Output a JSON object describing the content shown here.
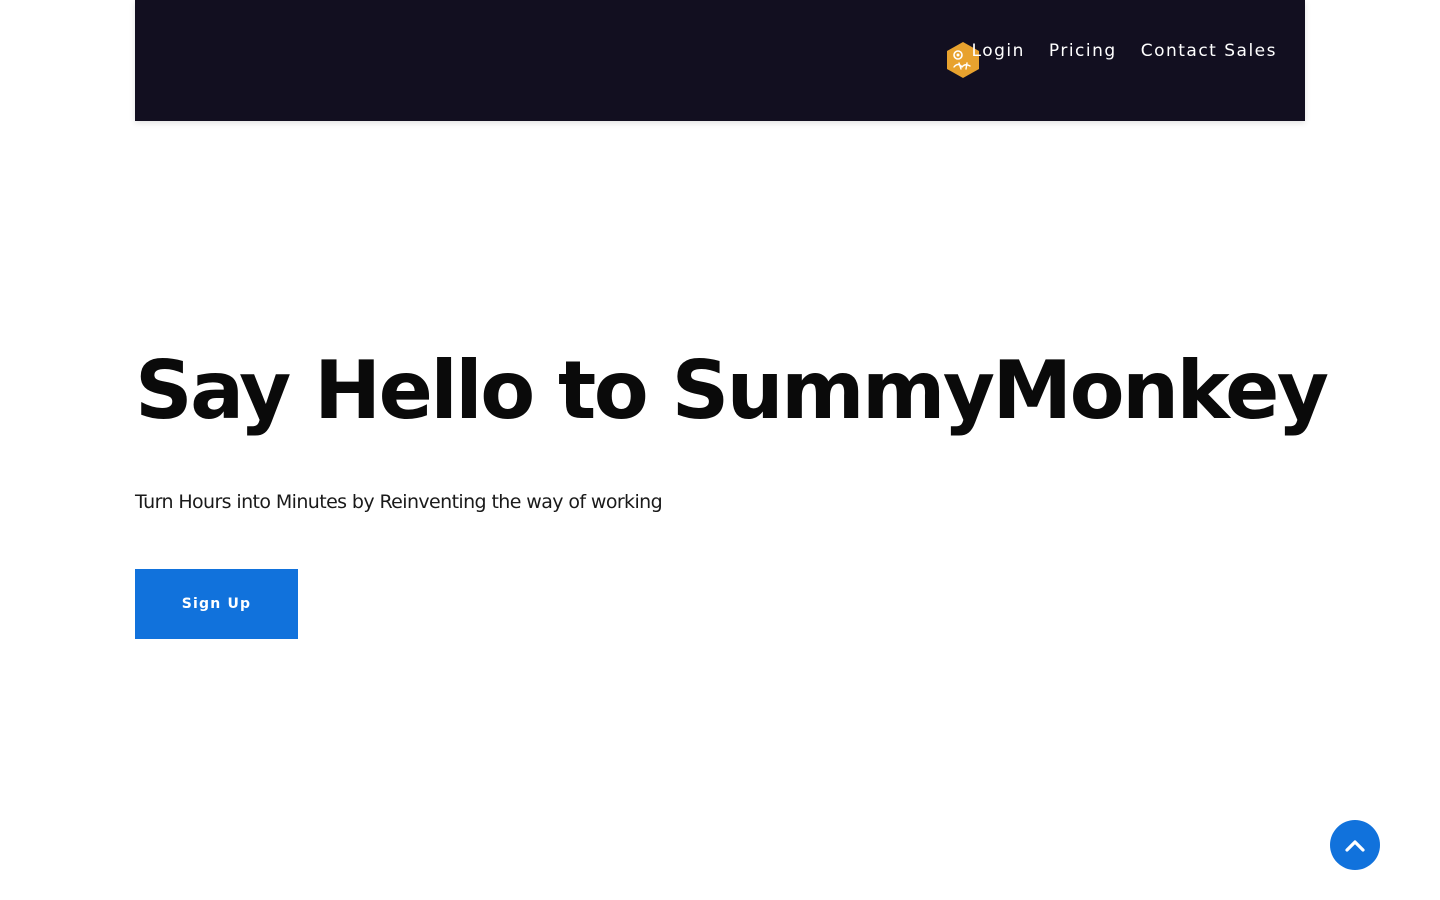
{
  "header": {
    "logo_icon": "monkey-hexagon-logo-icon",
    "logo_color": "#e8a22e",
    "nav": [
      {
        "label": "Login"
      },
      {
        "label": "Pricing"
      },
      {
        "label": "Contact Sales"
      }
    ]
  },
  "hero": {
    "title": "Say Hello to SummyMonkey",
    "subtitle": "Turn Hours into Minutes by Reinventing the way of working",
    "cta_label": "Sign Up"
  },
  "scroll_top_icon": "chevron-up-icon",
  "colors": {
    "header_bg": "#120f20",
    "accent": "#1172dc",
    "text": "#0a0a0a"
  }
}
